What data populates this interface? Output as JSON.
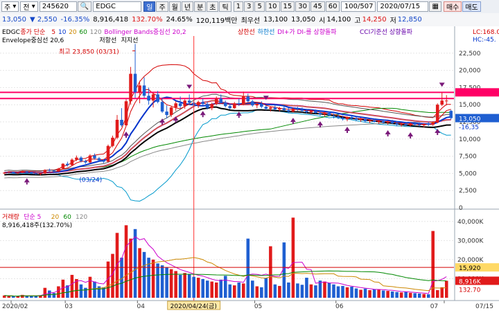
{
  "toolbar": {
    "market": "주",
    "mode": "전",
    "code": "245620",
    "name": "EDGC",
    "periods": [
      "일",
      "주",
      "월",
      "년",
      "분",
      "초",
      "틱"
    ],
    "active_period": "일",
    "intervals": [
      "1",
      "3",
      "5",
      "10",
      "15",
      "30",
      "45",
      "60"
    ],
    "count": "100",
    "count_total": "/507",
    "date": "2020/07/15",
    "buy_label": "매수",
    "sell_label": "매도"
  },
  "quote": {
    "price": "13,050",
    "change": "▼ 2,550",
    "change_pct": "-16.35%",
    "volume": "8,916,418",
    "volume_ratio": "132.70%",
    "turnover": "24.65%",
    "amount": "120,119백만",
    "ask_label": "최우선",
    "ask": "13,100",
    "bid": "13,050",
    "open_label": "시",
    "open": "14,100",
    "high_label": "고",
    "high": "14,250",
    "low_label": "저",
    "low": "12,850"
  },
  "price_panel": {
    "legend1": [
      {
        "text": "EDGC",
        "color": "#000000"
      },
      {
        "text": "종가 단순",
        "color": "#d40000"
      },
      {
        "text": "5",
        "color": "#d40000"
      },
      {
        "text": "10",
        "color": "#0033cc"
      },
      {
        "text": "20",
        "color": "#cc8800"
      },
      {
        "text": "60",
        "color": "#008800"
      },
      {
        "text": "120",
        "color": "#888888"
      },
      {
        "text": "Bollinger Bands중심선 20,2",
        "color": "#cc00cc"
      },
      {
        "text": "상한선",
        "color": "#d40000"
      },
      {
        "text": "하한선",
        "color": "#0077cc"
      },
      {
        "text": "DI+가 DI-를 상향돌파",
        "color": "#cc00cc"
      },
      {
        "text": "CCI기준선 상향돌파",
        "color": "#6600aa"
      }
    ],
    "legend2": [
      {
        "text": "Envelope중심선 20,6",
        "color": "#000000"
      },
      {
        "text": "저항선",
        "color": "#000000"
      },
      {
        "text": "지지선",
        "color": "#000000"
      }
    ],
    "right_top1": "LC:168.0",
    "right_top2": "HC:-45.",
    "max_annotation": "최고 23,850 (03/31)",
    "min_annotation": "(03/24)",
    "y_ticks": [
      "22,500",
      "20,000",
      "17,500",
      "15,000",
      "12,500",
      "10,000",
      "7,500",
      "5,000",
      "2,500",
      "0"
    ],
    "price_tag": "13,050",
    "change_tag": "-16,35"
  },
  "volume_panel": {
    "legend": [
      {
        "text": "거래량",
        "color": "#d40000"
      },
      {
        "text": "단순 5",
        "color": "#cc00cc"
      },
      {
        "text": "20",
        "color": "#cc8800"
      },
      {
        "text": "60",
        "color": "#008800"
      },
      {
        "text": "120",
        "color": "#888888"
      }
    ],
    "info": "8,916,418주(132.70%)",
    "y_ticks": [
      "40,000K",
      "30,000K",
      "20,000K",
      "10,000K"
    ],
    "tag_ma": "15,920",
    "tag_vol": "8,916K",
    "tag_pct": "132.70"
  },
  "x_axis": {
    "labels": [
      "2020/02",
      "03",
      "04",
      "05",
      "06",
      "07",
      "07/15"
    ],
    "cursor_label": "2020/04/24(금)"
  },
  "colors": {
    "up": "#e11b1b",
    "down": "#1f5fd1",
    "ma5": "#d40000",
    "ma10": "#0033cc",
    "ma20": "#cc8800",
    "ma60": "#008800",
    "ma120": "#888888",
    "bb_mid": "#cc00cc",
    "bb_up": "#d40000",
    "bb_low": "#0099cc",
    "envelope": "#000000",
    "resistance": "#ff0066"
  },
  "chart_data": {
    "type": "candlestick",
    "x": [
      "2020/02",
      "03",
      "04",
      "05",
      "06",
      "07"
    ],
    "ylim": [
      0,
      25000
    ],
    "max": {
      "value": 23850,
      "date": "03/31"
    },
    "min_date": "03/24",
    "last": {
      "date": "2020/07/15",
      "close": 13050,
      "open": 14100,
      "high": 14250,
      "low": 12850,
      "volume": 8916418
    },
    "ohlc": [
      [
        5000,
        5200,
        4900,
        5100
      ],
      [
        5100,
        5300,
        5000,
        5200
      ],
      [
        5200,
        5250,
        5000,
        5050
      ],
      [
        5050,
        5150,
        4950,
        5100
      ],
      [
        5100,
        5400,
        5050,
        5300
      ],
      [
        5300,
        5350,
        5100,
        5150
      ],
      [
        5150,
        5200,
        4900,
        5000
      ],
      [
        5000,
        5100,
        4800,
        4900
      ],
      [
        4900,
        5050,
        4700,
        5000
      ],
      [
        5000,
        5600,
        4950,
        5500
      ],
      [
        5500,
        5700,
        5300,
        5400
      ],
      [
        5400,
        5500,
        5150,
        5250
      ],
      [
        5250,
        5800,
        5200,
        5700
      ],
      [
        5700,
        6500,
        5650,
        6400
      ],
      [
        6400,
        6700,
        6000,
        6200
      ],
      [
        6200,
        7200,
        6100,
        7000
      ],
      [
        7000,
        7600,
        6800,
        7300
      ],
      [
        7300,
        7500,
        6600,
        6800
      ],
      [
        6800,
        7000,
        6400,
        6600
      ],
      [
        6600,
        7800,
        6500,
        7600
      ],
      [
        7600,
        7900,
        7000,
        7200
      ],
      [
        7200,
        7400,
        6700,
        6900
      ],
      [
        6900,
        7100,
        6500,
        6700
      ],
      [
        6700,
        9200,
        6600,
        9000
      ],
      [
        9000,
        10500,
        8800,
        10200
      ],
      [
        10200,
        13500,
        10000,
        12800
      ],
      [
        12800,
        14500,
        11800,
        12000
      ],
      [
        12000,
        15800,
        11900,
        15500
      ],
      [
        15500,
        20500,
        15000,
        19500
      ],
      [
        19500,
        23850,
        16000,
        16800
      ],
      [
        16800,
        18500,
        15200,
        17800
      ],
      [
        17800,
        19000,
        16000,
        16300
      ],
      [
        16300,
        17500,
        15000,
        15600
      ],
      [
        15600,
        16800,
        14600,
        16500
      ],
      [
        16500,
        17000,
        15200,
        15400
      ],
      [
        15400,
        16000,
        13800,
        14000
      ],
      [
        14000,
        14900,
        13000,
        13500
      ],
      [
        13500,
        14800,
        13200,
        14600
      ],
      [
        14600,
        15500,
        14100,
        15200
      ],
      [
        15200,
        16200,
        14500,
        14800
      ],
      [
        14800,
        15800,
        14400,
        15600
      ],
      [
        15600,
        16500,
        15000,
        15300
      ],
      [
        15300,
        15800,
        14600,
        14900
      ],
      [
        14900,
        15600,
        14500,
        15400
      ],
      [
        15400,
        15900,
        14900,
        15100
      ],
      [
        15100,
        15400,
        14300,
        14500
      ],
      [
        14500,
        15300,
        14200,
        15100
      ],
      [
        15100,
        16200,
        14900,
        15900
      ],
      [
        15900,
        16500,
        15200,
        15300
      ],
      [
        15300,
        15600,
        14600,
        14800
      ],
      [
        14800,
        15200,
        14300,
        14500
      ],
      [
        14500,
        15400,
        14400,
        15200
      ],
      [
        15200,
        15900,
        14800,
        15100
      ],
      [
        15100,
        16900,
        14900,
        16200
      ],
      [
        16200,
        16600,
        15300,
        15500
      ],
      [
        15500,
        15700,
        14700,
        14900
      ],
      [
        14900,
        15300,
        14500,
        15100
      ],
      [
        15100,
        15500,
        14500,
        14700
      ],
      [
        14700,
        14900,
        14200,
        14400
      ],
      [
        14400,
        14800,
        14000,
        14600
      ],
      [
        14600,
        14900,
        14200,
        14300
      ],
      [
        14300,
        14700,
        14000,
        14500
      ],
      [
        14500,
        14800,
        14100,
        14200
      ],
      [
        14200,
        14500,
        13800,
        14000
      ],
      [
        14000,
        14600,
        13900,
        14400
      ],
      [
        14400,
        14700,
        14100,
        14300
      ],
      [
        14300,
        14600,
        13900,
        14100
      ],
      [
        14100,
        14400,
        13700,
        13900
      ],
      [
        13900,
        14300,
        13600,
        14100
      ],
      [
        14100,
        14300,
        13700,
        13800
      ],
      [
        13800,
        14100,
        13400,
        13600
      ],
      [
        13600,
        14000,
        13300,
        13800
      ],
      [
        13800,
        14000,
        13300,
        13400
      ],
      [
        13400,
        13700,
        13000,
        13300
      ],
      [
        13300,
        13600,
        12900,
        13100
      ],
      [
        13100,
        13400,
        12700,
        12900
      ],
      [
        12900,
        13300,
        12600,
        13200
      ],
      [
        13200,
        13400,
        12800,
        13000
      ],
      [
        13000,
        13200,
        12600,
        12800
      ],
      [
        12800,
        13100,
        12500,
        12900
      ],
      [
        12900,
        13100,
        12400,
        12600
      ],
      [
        12600,
        12900,
        12300,
        12700
      ],
      [
        12700,
        13000,
        12400,
        12500
      ],
      [
        12500,
        12800,
        12200,
        12600
      ],
      [
        12600,
        12900,
        12200,
        12400
      ],
      [
        12400,
        12700,
        12100,
        12500
      ],
      [
        12500,
        12800,
        12200,
        12300
      ],
      [
        12300,
        12600,
        11900,
        12100
      ],
      [
        12100,
        12400,
        11800,
        12200
      ],
      [
        12200,
        12500,
        11900,
        12000
      ],
      [
        12000,
        12400,
        11800,
        12300
      ],
      [
        12300,
        12500,
        11900,
        12100
      ],
      [
        12100,
        12400,
        11800,
        12000
      ],
      [
        12000,
        12300,
        11700,
        12200
      ],
      [
        12200,
        12500,
        11900,
        12100
      ],
      [
        12100,
        12600,
        11900,
        12400
      ],
      [
        12400,
        15200,
        12300,
        15000
      ],
      [
        15000,
        16800,
        14800,
        15600
      ],
      [
        15600,
        16400,
        14900,
        15600
      ],
      [
        14100,
        14250,
        12850,
        13050
      ]
    ],
    "volume_k": [
      1200,
      900,
      700,
      800,
      1500,
      1100,
      900,
      1000,
      1300,
      5200,
      3800,
      2500,
      6000,
      9500,
      6500,
      12000,
      9800,
      7000,
      5200,
      11000,
      8500,
      6000,
      5500,
      19000,
      23000,
      34000,
      21000,
      38000,
      31000,
      36000,
      26000,
      24000,
      21000,
      20000,
      18000,
      17000,
      16000,
      15000,
      14000,
      12000,
      13000,
      12500,
      11000,
      10500,
      9800,
      9000,
      8500,
      8000,
      9500,
      11500,
      7000,
      6500,
      8000,
      7500,
      31000,
      9000,
      6000,
      5500,
      10500,
      27000,
      7000,
      6200,
      29000,
      8000,
      42000,
      7500,
      6800,
      10500,
      7000,
      6500,
      9000,
      8500,
      7800,
      7000,
      6000,
      6200,
      5500,
      5800,
      4900,
      4200,
      4800,
      4000,
      4500,
      4200,
      3800,
      3600,
      3300,
      3000,
      2800,
      3200,
      2600,
      2400,
      2200,
      2000,
      1800,
      35000,
      4000,
      5500,
      8916
    ],
    "series": [
      {
        "name": "5"
      },
      {
        "name": "10"
      },
      {
        "name": "20"
      },
      {
        "name": "60"
      },
      {
        "name": "120"
      }
    ],
    "resistance": [
      16800,
      15900
    ],
    "arrow_markers": [
      {
        "i": 5,
        "kind": "up"
      },
      {
        "i": 27,
        "kind": "up"
      },
      {
        "i": 35,
        "kind": "up"
      },
      {
        "i": 38,
        "kind": "up"
      },
      {
        "i": 41,
        "kind": "down"
      },
      {
        "i": 44,
        "kind": "up"
      },
      {
        "i": 52,
        "kind": "up"
      },
      {
        "i": 58,
        "kind": "down"
      },
      {
        "i": 64,
        "kind": "up"
      },
      {
        "i": 70,
        "kind": "up"
      },
      {
        "i": 76,
        "kind": "up"
      },
      {
        "i": 85,
        "kind": "up"
      },
      {
        "i": 90,
        "kind": "up"
      },
      {
        "i": 96,
        "kind": "up"
      },
      {
        "i": 97,
        "kind": "down"
      }
    ]
  }
}
